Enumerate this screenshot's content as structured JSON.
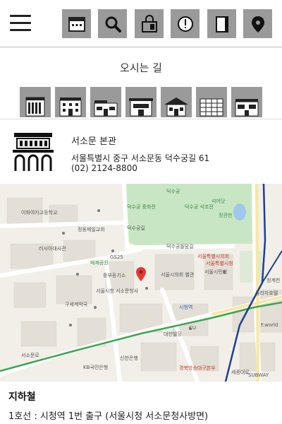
{
  "toolbar": {
    "menu_icon": "hamburger-menu-icon",
    "icons": [
      "calendar-icon",
      "search-icon",
      "shopping-bag-icon",
      "info-alert-icon",
      "notebook-icon",
      "location-pin-icon"
    ],
    "icon_bg": "#9a9a9a"
  },
  "page": {
    "title": "오시는 길"
  },
  "branches": [
    "building-1-icon",
    "building-2-icon",
    "building-3-icon",
    "building-4-icon",
    "building-5-icon",
    "building-6-icon",
    "building-7-icon"
  ],
  "info": {
    "name": "서소문 본관",
    "address": "서울특별시 중구 서소문동 덕수궁길 61",
    "phone": "(02) 2124-8800"
  },
  "map": {
    "labels": {
      "l1": "덕수궁",
      "l2": "덕수궁 중화전",
      "l3": "덕수궁 석조전",
      "l4": "석어당",
      "l5": "정관헌",
      "l6": "덕수궁돌담길",
      "l7": "덕수궁길",
      "l8": "이화여자고등학교",
      "l9": "정동제일교회",
      "l10": "러시아대사관",
      "l11": "배재공원",
      "l12": "GS25",
      "l13": "중부등기소",
      "l14": "서울특별시의회",
      "l15": "서울시민청",
      "l16": "서울특별시청",
      "l17": "서울시청 서소문청사",
      "l18": "시청역",
      "l19": "서소문로",
      "l20": "세종대로",
      "l21": "KB국민은행",
      "l22": "CU",
      "l23": "서울시의회 별관",
      "l24": "신한은행",
      "l25": "SUBWAY",
      "l26": "F.world",
      "l27": "플라자호텔",
      "l28": "구세계약국",
      "l29": "대한빌딩",
      "l30": "경북방송대구본부",
      "l31": "청계천"
    }
  },
  "subway": {
    "title": "지하철",
    "line1": "1호선 : 시청역 1번 출구 (서울시청 서소문청사방면)"
  }
}
